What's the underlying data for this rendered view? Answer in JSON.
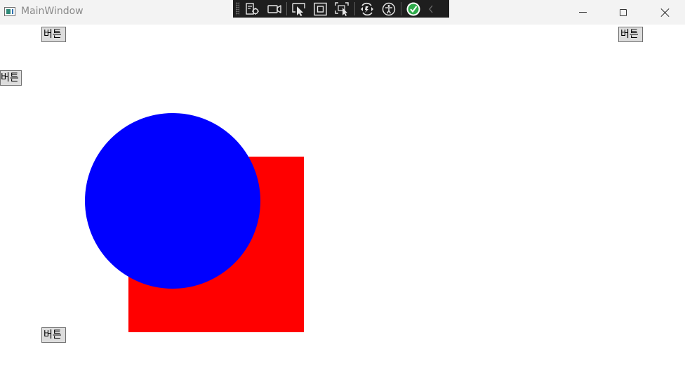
{
  "window": {
    "title": "MainWindow"
  },
  "buttons": {
    "top_left": "버튼",
    "top_right": "버튼",
    "mid_left": "버튼",
    "bottom_left": "버튼"
  },
  "debug_toolbar": {
    "icons": [
      "live-visual-tree-icon",
      "video-icon",
      "select-element-icon",
      "display-layout-adorners-icon",
      "track-focus-icon",
      "hot-reload-icon",
      "accessibility-icon",
      "binding-check-icon",
      "collapse-chevron-icon"
    ]
  },
  "shapes": {
    "rectangle_color": "#ff0000",
    "circle_color": "#0000ff"
  }
}
